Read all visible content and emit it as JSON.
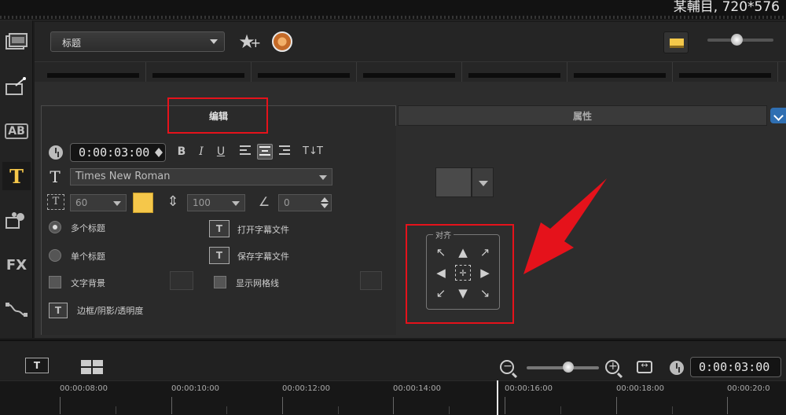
{
  "window": {
    "title_fragment": "某輔目, 720*576"
  },
  "leftbar": {
    "fx_label": "FX",
    "ab_label": "AB",
    "t_label": "T"
  },
  "toolbar": {
    "category_value": "标题"
  },
  "tabs": {
    "edit": "编辑",
    "attributes": "属性"
  },
  "edit": {
    "duration": "0:00:03:00",
    "font_name": "Times New Roman",
    "font_size": "60",
    "line_spacing": "100",
    "rotation": "0",
    "multi_title": "多个标题",
    "single_title": "单个标题",
    "text_background": "文字背景",
    "border_shadow": "边框/阴影/透明度",
    "open_subtitle": "打开字幕文件",
    "save_subtitle": "保存字幕文件",
    "show_grid": "显示网格线",
    "format": {
      "bold": "B",
      "italic": "I",
      "underline": "U"
    }
  },
  "attributes": {
    "align_group_label": "对齐"
  },
  "timeline": {
    "timecode": "0:00:03:00",
    "text_tool": "T",
    "ticks": [
      "00:00:08:00",
      "00:00:10:00",
      "00:00:12:00",
      "00:00:14:00",
      "00:00:16:00",
      "00:00:18:00",
      "00:00:20:0"
    ]
  },
  "colors": {
    "highlight_red": "#e5121b",
    "text_color_swatch": "#f5c74a",
    "accent_blue": "#2f6fb2"
  },
  "icons": [
    "clip-icon",
    "fx-wand-icon",
    "transition-ab-icon",
    "title-t-icon",
    "graphics-icon",
    "filter-fx-icon",
    "path-icon",
    "star-plus-icon",
    "color-wheel-icon",
    "view-toggle-icon",
    "clock-icon",
    "font-t-icon",
    "font-size-icon",
    "line-spacing-icon",
    "rotate-angle-icon",
    "open-subtitle-icon",
    "save-subtitle-icon",
    "zoom-out-icon",
    "zoom-in-icon",
    "fit-icon",
    "timecode-clock-icon"
  ]
}
